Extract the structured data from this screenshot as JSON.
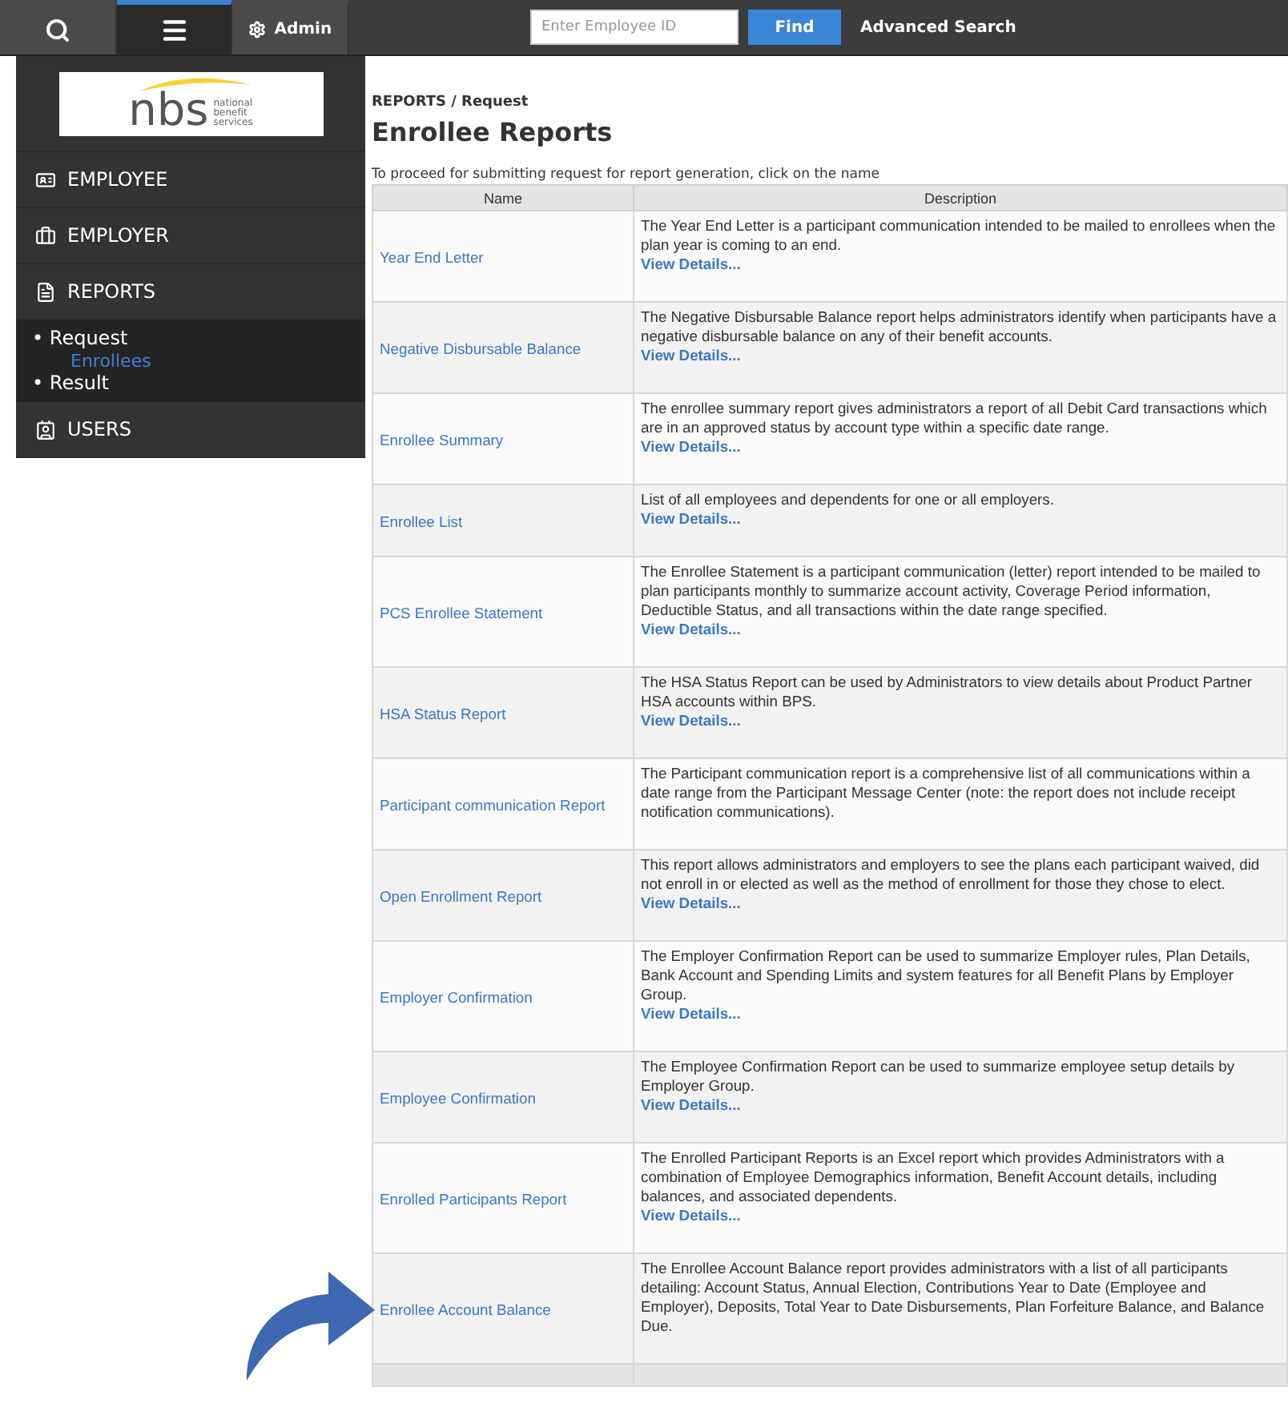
{
  "topbar": {
    "tabs": [
      {
        "selected": false
      },
      {
        "selected": true
      },
      {
        "label": "Admin",
        "selected": false
      }
    ],
    "search": {
      "placeholder": "Enter Employee ID"
    },
    "find_button": "Find",
    "advanced_link": "Advanced Search"
  },
  "sidebar": {
    "logo": {
      "mark": "nbs",
      "tagline": [
        "national",
        "benefit",
        "services"
      ]
    },
    "items": [
      {
        "label": "EMPLOYEE"
      },
      {
        "label": "EMPLOYER"
      },
      {
        "label": "REPORTS",
        "children": [
          {
            "marker": "•",
            "label": "Request",
            "selected": false,
            "children": [
              {
                "label": "Enrollees",
                "selected": true
              }
            ]
          },
          {
            "marker": "•",
            "label": "Result",
            "selected": false
          }
        ]
      },
      {
        "label": "USERS"
      }
    ]
  },
  "breadcrumb": "REPORTS / Request",
  "title": "Enrollee Reports",
  "instruction": "To proceed for submitting request for report generation, click on the name",
  "table": {
    "columns": [
      "Name",
      "Description"
    ],
    "rows": [
      {
        "name": "Year End Letter",
        "description": "The Year End Letter is a participant communication intended to be mailed to enrollees when the plan year is coming to an end.",
        "link": "View Details..."
      },
      {
        "name": "Negative Disbursable Balance",
        "description": "The Negative Disbursable Balance report helps administrators identify when participants have a negative disbursable balance on any of their benefit accounts.",
        "link": "View Details..."
      },
      {
        "name": "Enrollee Summary",
        "description": "The enrollee summary report gives administrators a report of all Debit Card transactions which are in an approved status by account type within a specific date range.",
        "link": "View Details..."
      },
      {
        "name": "Enrollee List",
        "description": "List of all employees and dependents for one or all employers.",
        "link": "View Details..."
      },
      {
        "name": "PCS Enrollee Statement",
        "description": "The Enrollee Statement is a participant communication (letter) report intended to be mailed to plan participants monthly to summarize account activity, Coverage Period information, Deductible Status, and all transactions within the date range specified.",
        "link": "View Details..."
      },
      {
        "name": "HSA Status Report",
        "description": "The HSA Status Report can be used by Administrators to view details about Product Partner HSA accounts within BPS.",
        "link": "View Details..."
      },
      {
        "name": "Participant communication Report",
        "description": "The Participant communication report is a comprehensive list of all communications within a date range from the Participant Message Center (note: the report does not include receipt notification communications)."
      },
      {
        "name": "Open Enrollment Report",
        "description": "This report allows administrators and employers to see the plans each participant waived, did not enroll in or elected as well as the method of enrollment for those they chose to elect.",
        "link": "View Details..."
      },
      {
        "name": "Employer Confirmation",
        "description": "The Employer Confirmation Report can be used to summarize Employer rules, Plan Details, Bank Account and Spending Limits and system features for all Benefit Plans by Employer Group.",
        "link": "View Details..."
      },
      {
        "name": "Employee Confirmation",
        "description": "The Employee Confirmation Report can be used to summarize employee setup details by Employer Group.",
        "link": "View Details..."
      },
      {
        "name": "Enrolled Participants Report",
        "description": "The Enrolled Participant Reports is an Excel report which provides Administrators with a combination of Employee Demographics information, Benefit Account details, including balances, and associated dependents.",
        "link": "View Details..."
      },
      {
        "name": "Enrollee Account Balance",
        "description": "The Enrollee Account Balance report provides administrators with a list of all participants detailing: Account Status, Annual Election, Contributions Year to Date (Employee and Employer), Deposits, Total Year to Date Disbursements, Plan Forfeiture Balance, and Balance Due."
      }
    ]
  }
}
